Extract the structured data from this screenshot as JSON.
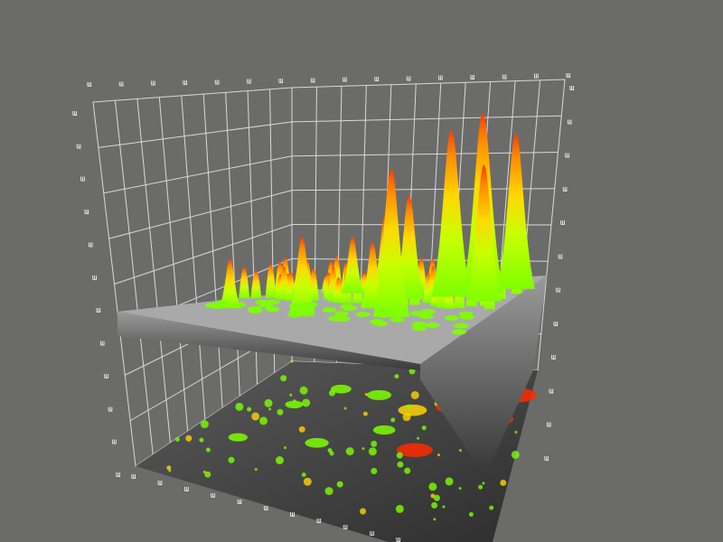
{
  "chart_data": {
    "type": "surface3d",
    "title": "",
    "xlabel": "",
    "ylabel": "",
    "zlabel": "",
    "grid": true,
    "colormap": [
      "#7dff00",
      "#c8ff00",
      "#ffe600",
      "#ff9a00",
      "#ff3a00"
    ],
    "projection_colormap": [
      "#2b2b2b",
      "#9a9a9a",
      "#7dff00",
      "#ffd400",
      "#ff2a00"
    ],
    "base_color": "#a9a9a9",
    "background": "#6b6c6a",
    "tick_label_glyph": "ɯ",
    "tick_labels": {
      "left_vertical": [
        "ɯ",
        "ɯ",
        "ɯ",
        "ɯ",
        "ɯ",
        "ɯ",
        "ɯ",
        "ɯ",
        "ɯ",
        "ɯ",
        "ɯ",
        "ɯ"
      ],
      "back_top": [
        "ɯ",
        "ɯ",
        "ɯ",
        "ɯ",
        "ɯ",
        "ɯ",
        "ɯ",
        "ɯ",
        "ɯ",
        "ɯ",
        "ɯ",
        "ɯ",
        "ɯ",
        "ɯ",
        "ɯ",
        "ɯ"
      ],
      "right_vertical": [
        "ɯ",
        "ɯ",
        "ɯ",
        "ɯ",
        "ɯ",
        "ɯ",
        "ɯ",
        "ɯ",
        "ɯ",
        "ɯ",
        "ɯ",
        "ɯ"
      ],
      "front_bottom": [
        "ɯ",
        "ɯ",
        "ɯ",
        "ɯ",
        "ɯ",
        "ɯ",
        "ɯ",
        "ɯ",
        "ɯ",
        "ɯ",
        "ɯ"
      ]
    },
    "peaks": [
      {
        "x": 0.84,
        "y": 0.2,
        "z": 0.95
      },
      {
        "x": 0.74,
        "y": 0.25,
        "z": 0.88
      },
      {
        "x": 0.95,
        "y": 0.15,
        "z": 0.82
      },
      {
        "x": 0.68,
        "y": 0.55,
        "z": 0.78
      },
      {
        "x": 0.9,
        "y": 0.3,
        "z": 0.72
      },
      {
        "x": 0.6,
        "y": 0.3,
        "z": 0.55
      },
      {
        "x": 0.45,
        "y": 0.22,
        "z": 0.42
      },
      {
        "x": 0.3,
        "y": 0.2,
        "z": 0.3
      },
      {
        "x": 0.38,
        "y": 0.6,
        "z": 0.4
      },
      {
        "x": 0.15,
        "y": 0.65,
        "z": 0.26
      },
      {
        "x": 0.55,
        "y": 0.45,
        "z": 0.35
      },
      {
        "x": 0.2,
        "y": 0.35,
        "z": 0.22
      }
    ]
  }
}
